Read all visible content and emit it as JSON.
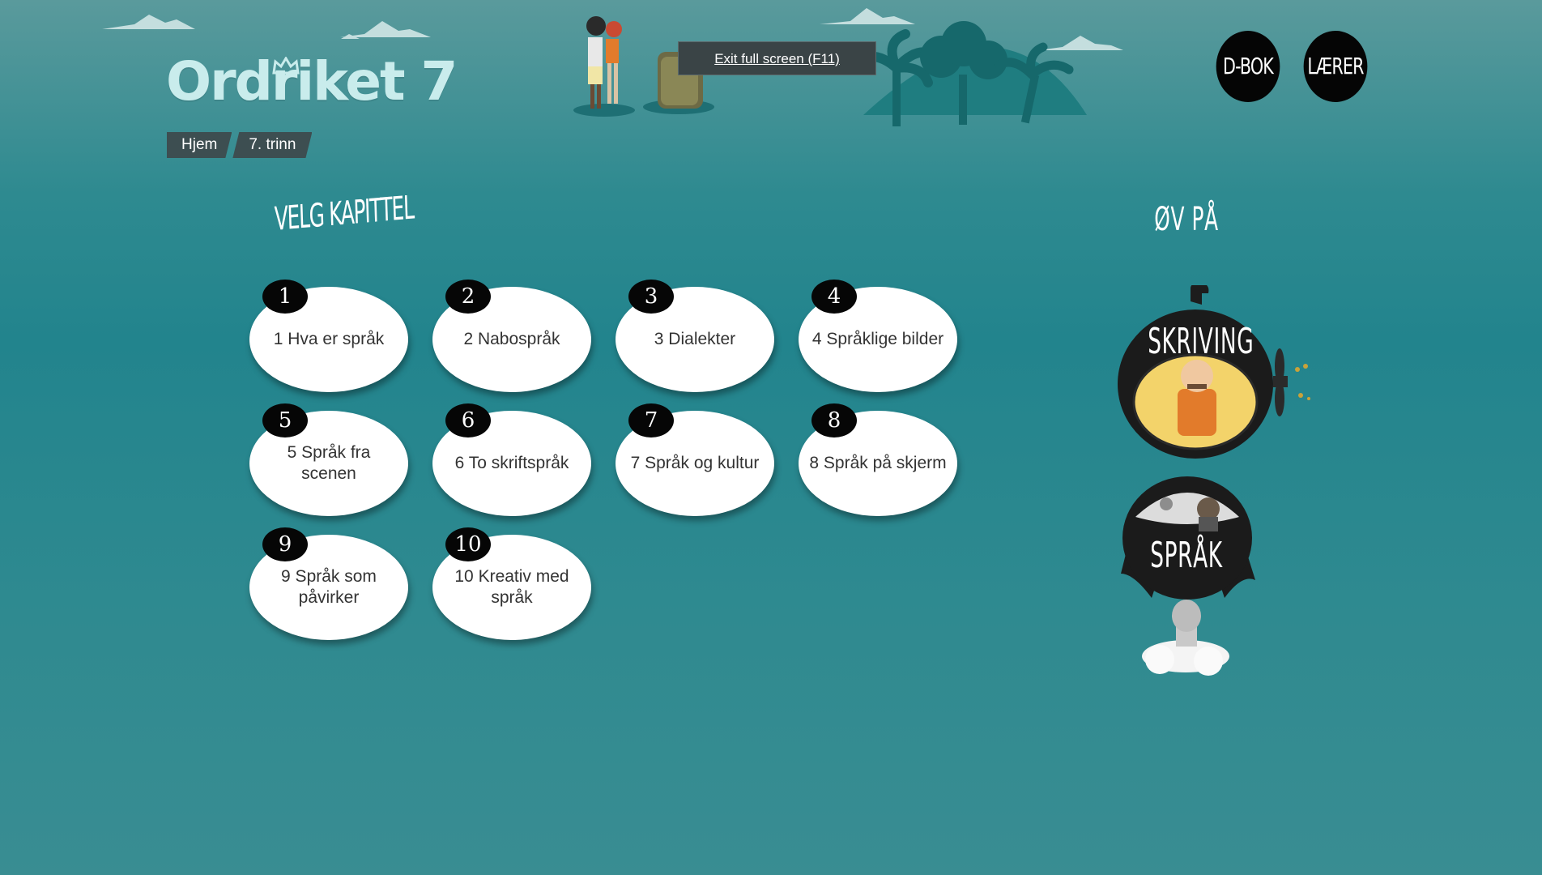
{
  "logo": {
    "text": "Ordriket 7"
  },
  "breadcrumb": {
    "home": "Hjem",
    "grade": "7. trinn"
  },
  "fullscreen_tip": "Exit full screen (F11)",
  "header_buttons": {
    "dbok": "D-BOK",
    "teacher": "LÆRER"
  },
  "chapters_section": {
    "title": "VELG KAPITTEL"
  },
  "chapters": [
    {
      "num": "1",
      "label": "1 Hva er språk"
    },
    {
      "num": "2",
      "label": "2 Nabospråk"
    },
    {
      "num": "3",
      "label": "3 Dialekter"
    },
    {
      "num": "4",
      "label": "4 Språklige bilder"
    },
    {
      "num": "5",
      "label": "5 Språk fra scenen"
    },
    {
      "num": "6",
      "label": "6 To skriftspråk"
    },
    {
      "num": "7",
      "label": "7 Språk og kultur"
    },
    {
      "num": "8",
      "label": "8 Språk på skjerm"
    },
    {
      "num": "9",
      "label": "9 Språk som påvirker"
    },
    {
      "num": "10",
      "label": "10 Kreativ med språk"
    }
  ],
  "practice_section": {
    "title": "ØV PÅ",
    "items": [
      {
        "label": "SKRIVING",
        "icon": "submarine-writer-icon"
      },
      {
        "label": "SPRÅK",
        "icon": "rocket-language-icon"
      }
    ]
  },
  "colors": {
    "background": "#2e8a90",
    "accent_dark": "#050505",
    "crumb": "#3d4e51",
    "logo": "#c9ecec"
  }
}
